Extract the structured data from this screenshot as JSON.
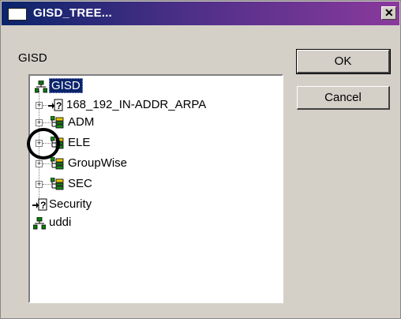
{
  "window": {
    "title": "GISD_TREE..."
  },
  "dialog": {
    "context_label": "GISD",
    "ok_label": "OK",
    "cancel_label": "Cancel"
  },
  "tree": {
    "root": "GISD",
    "children": [
      {
        "label": "168_192_IN-ADDR_ARPA",
        "icon": "unknown-link-icon"
      },
      {
        "label": "ADM",
        "icon": "org-unit-icon"
      },
      {
        "label": "ELE",
        "icon": "org-unit-icon"
      },
      {
        "label": "GroupWise",
        "icon": "org-unit-icon"
      },
      {
        "label": "SEC",
        "icon": "org-unit-icon"
      }
    ],
    "others": [
      {
        "label": "Security",
        "icon": "unknown-link-icon"
      },
      {
        "label": "uddi",
        "icon": "tree-icon"
      }
    ]
  }
}
